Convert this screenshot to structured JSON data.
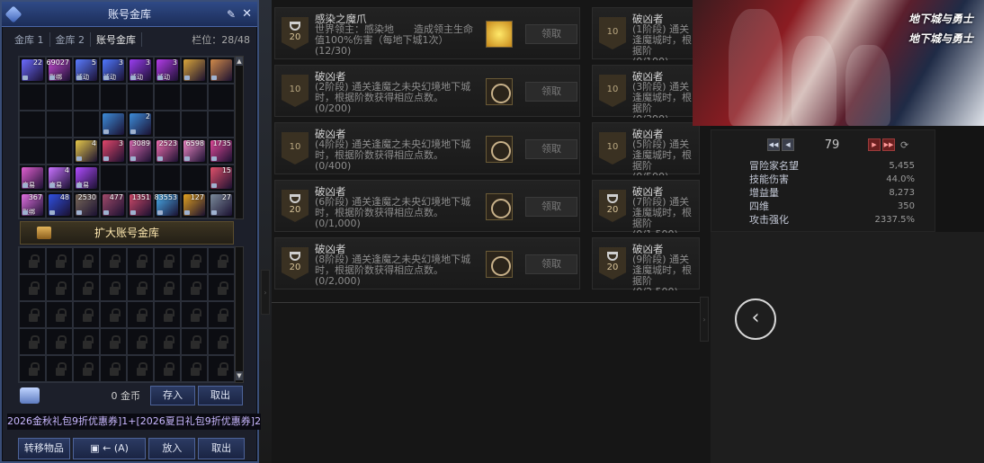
{
  "vault": {
    "title": "账号金库",
    "tabs": [
      "金库 1",
      "金库 2",
      "账号金库"
    ],
    "slots": "栏位：28/48",
    "items_row1": [
      {
        "num": "22",
        "tag": "",
        "color": "#6b6bff"
      },
      {
        "num": "69027",
        "tag": "账绑",
        "color": "#c54bd4"
      },
      {
        "num": "5",
        "tag": "活动",
        "color": "#5a7cff"
      },
      {
        "num": "3",
        "tag": "活动",
        "color": "#4f78ff"
      },
      {
        "num": "3",
        "tag": "活动",
        "color": "#9a3df0"
      },
      {
        "num": "3",
        "tag": "活动",
        "color": "#b33ce8"
      },
      {
        "num": "",
        "tag": "",
        "color": "#d9a53b"
      },
      {
        "num": "",
        "tag": "",
        "color": "#d08a4a"
      }
    ],
    "items_row4": [
      {
        "num": "",
        "tag": "",
        "color": ""
      },
      {
        "num": "",
        "tag": "",
        "color": ""
      },
      {
        "num": "4",
        "tag": "",
        "color": "#e6c84a"
      },
      {
        "num": "3",
        "tag": "",
        "color": "#e0466a"
      },
      {
        "num": "3089",
        "tag": "",
        "color": "#d86ab0"
      },
      {
        "num": "2523",
        "tag": "",
        "color": "#f06fb0"
      },
      {
        "num": "6598",
        "tag": "",
        "color": "#f08ac8"
      },
      {
        "num": "1735",
        "tag": "",
        "color": "#e04a9a"
      }
    ],
    "items_row5": [
      {
        "num": "",
        "tag": "交易",
        "color": "#e05fd0"
      },
      {
        "num": "4",
        "tag": "交易",
        "color": "#c873ff"
      },
      {
        "num": "",
        "tag": "交易",
        "color": "#b04cff"
      },
      {
        "num": "",
        "tag": "",
        "color": ""
      },
      {
        "num": "",
        "tag": "",
        "color": ""
      },
      {
        "num": "",
        "tag": "",
        "color": ""
      },
      {
        "num": "",
        "tag": "",
        "color": ""
      },
      {
        "num": "15",
        "tag": "",
        "color": "#e0506a"
      }
    ],
    "items_row6": [
      {
        "num": "367",
        "tag": "账绑",
        "color": "#e070e0"
      },
      {
        "num": "48",
        "tag": "",
        "color": "#3050e0"
      },
      {
        "num": "2530",
        "tag": "",
        "color": "#7a6a5a"
      },
      {
        "num": "477",
        "tag": "",
        "color": "#a04a6a"
      },
      {
        "num": "1351",
        "tag": "",
        "color": "#d04a6a"
      },
      {
        "num": "83553",
        "tag": "",
        "color": "#4ab0f0"
      },
      {
        "num": "127",
        "tag": "",
        "color": "#e0a020"
      },
      {
        "num": "27",
        "tag": "",
        "color": "#7a8a9a"
      }
    ],
    "items_row3": [
      {
        "num": "",
        "tag": "",
        "color": ""
      },
      {
        "num": "",
        "tag": "",
        "color": ""
      },
      {
        "num": "",
        "tag": "",
        "color": ""
      },
      {
        "num": "",
        "tag": "",
        "color": "#3d8cd8"
      },
      {
        "num": "2",
        "tag": "",
        "color": "#3d8cd8"
      },
      {
        "num": "",
        "tag": "",
        "color": ""
      },
      {
        "num": "",
        "tag": "",
        "color": ""
      },
      {
        "num": "",
        "tag": "",
        "color": ""
      }
    ],
    "expand_label": "扩大账号金库",
    "gold": "0 金币",
    "deposit": "存入",
    "withdraw": "取出",
    "marquee": "2026金秋礼包9折优惠券]1+[2026夏日礼包9折优惠券]2",
    "transfer": "转移物品",
    "auto_label": "← (A)",
    "put_in": "放入",
    "take_out": "取出"
  },
  "achievements_left": [
    {
      "points": "20",
      "cup": true,
      "title": "感染之魔爪",
      "desc": "世界领主：感染地　　造成领主生命值100%伤害（每地下城1次）",
      "progress": "(12/30)",
      "reward": "gold",
      "claim": "领取"
    },
    {
      "points": "10",
      "cup": false,
      "title": "破凶者",
      "desc": "(2阶段) 通关逢魔之未央幻境地下城时，根据阶数获得相应点数。",
      "progress": "(0/200)",
      "reward": "ring",
      "claim": "领取"
    },
    {
      "points": "10",
      "cup": false,
      "title": "破凶者",
      "desc": "(4阶段) 通关逢魔之未央幻境地下城时，根据阶数获得相应点数。",
      "progress": "(0/400)",
      "reward": "ring",
      "claim": "领取"
    },
    {
      "points": "20",
      "cup": true,
      "title": "破凶者",
      "desc": "(6阶段) 通关逢魔之未央幻境地下城时，根据阶数获得相应点数。",
      "progress": "(0/1,000)",
      "reward": "ring",
      "claim": "领取"
    },
    {
      "points": "20",
      "cup": true,
      "title": "破凶者",
      "desc": "(8阶段) 通关逢魔之未央幻境地下城时，根据阶数获得相应点数。",
      "progress": "(0/2,000)",
      "reward": "ring",
      "claim": "领取"
    }
  ],
  "achievements_right": [
    {
      "points": "10",
      "cup": false,
      "title": "破凶者",
      "desc": "(1阶段) 通关逢魔城时，根据阶",
      "progress": "(0/100)"
    },
    {
      "points": "10",
      "cup": false,
      "title": "破凶者",
      "desc": "(3阶段) 通关逢魔城时，根据阶",
      "progress": "(0/300)"
    },
    {
      "points": "10",
      "cup": false,
      "title": "破凶者",
      "desc": "(5阶段) 通关逢魔城时，根据阶",
      "progress": "(0/500)"
    },
    {
      "points": "20",
      "cup": true,
      "title": "破凶者",
      "desc": "(7阶段) 通关逢魔城时，根据阶",
      "progress": "(0/1,500)"
    },
    {
      "points": "20",
      "cup": true,
      "title": "破凶者",
      "desc": "(9阶段) 通关逢魔城时，根据阶",
      "progress": "(0/2,500)"
    }
  ],
  "banner": {
    "logo": "地下城与勇士"
  },
  "stats_panel": {
    "page": "79",
    "rows": [
      {
        "k": "冒险家名望",
        "v": "5,455"
      },
      {
        "k": "技能伤害",
        "v": "44.0%"
      },
      {
        "k": "增益量",
        "v": "8,273"
      },
      {
        "k": "四维",
        "v": "350"
      },
      {
        "k": "攻击强化",
        "v": "2337.5%"
      }
    ]
  },
  "back_label": "‹"
}
